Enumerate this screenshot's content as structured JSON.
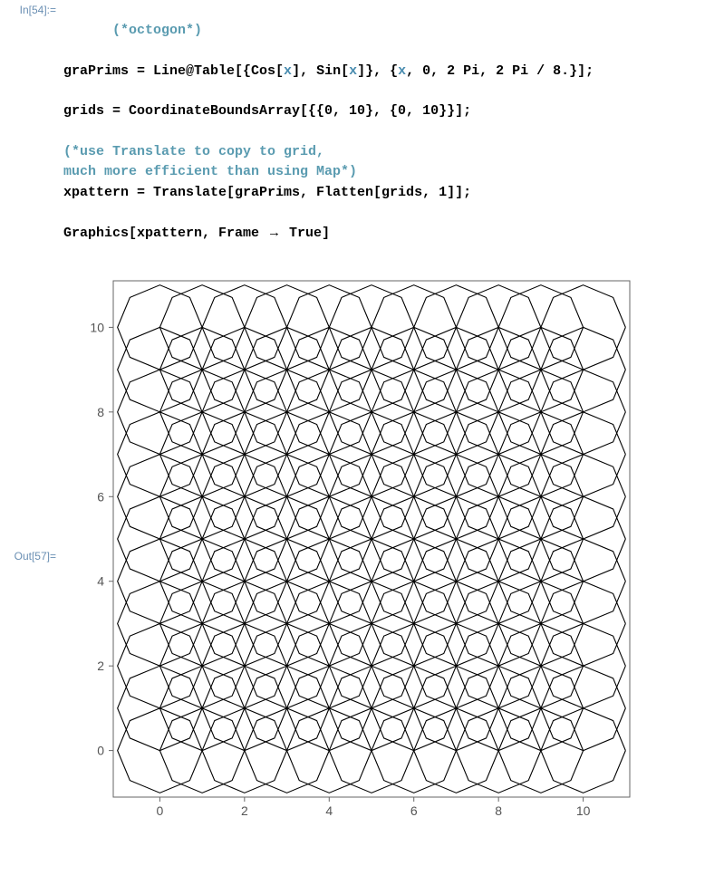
{
  "input_label": "In[54]:=",
  "output_label": "Out[57]=",
  "code_comment1": "(*octogon*)",
  "code_line1a": "graPrims = Line@Table[{Cos[",
  "code_line1b": "], Sin[",
  "code_line1c": "]}, {",
  "code_line1d": ", 0, 2 Pi, 2 Pi / 8.}];",
  "code_line2": "grids = CoordinateBoundsArray[{{0, 10}, {0, 10}}];",
  "code_comment2a": "(*use Translate to copy to grid,",
  "code_comment2b": "much more efficient than using Map*)",
  "code_line3": "xpattern = Translate[graPrims, Flatten[grids, 1]];",
  "code_line4a": "Graphics[xpattern, Frame ",
  "code_line4b": " True]",
  "var_x": "x",
  "arrow": "→",
  "chart_data": {
    "type": "pattern",
    "xlim": [
      -1.1,
      11.1
    ],
    "ylim": [
      -1.1,
      11.1
    ],
    "xticks": [
      0,
      2,
      4,
      6,
      8,
      10
    ],
    "yticks": [
      0,
      2,
      4,
      6,
      8,
      10
    ],
    "grid_range": {
      "x": [
        0,
        10
      ],
      "y": [
        0,
        10
      ]
    },
    "primitive": "octagon",
    "octagon_radius": 1,
    "octagon_sides": 8
  }
}
